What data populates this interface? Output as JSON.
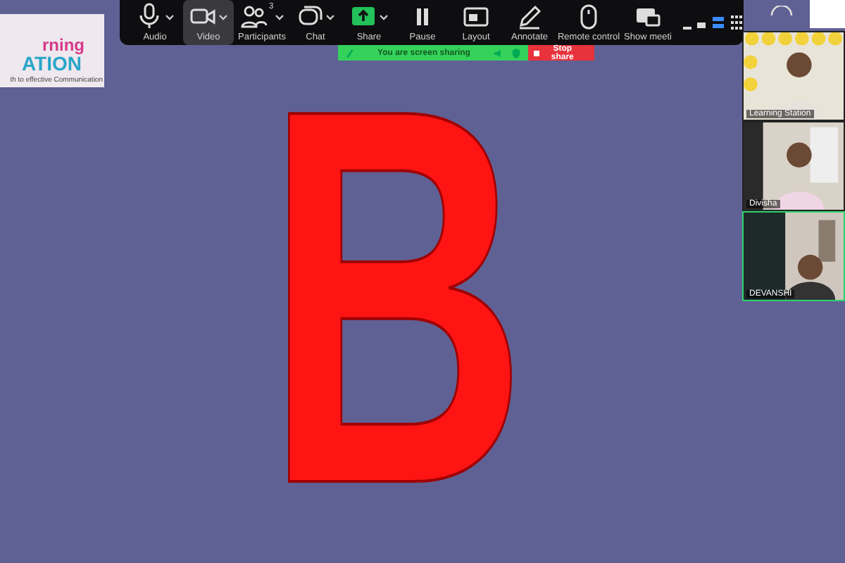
{
  "logo": {
    "lines": [
      "rning",
      "ATION",
      "th to effective Communication"
    ]
  },
  "toolbar": {
    "items": [
      {
        "kind": "mic",
        "label": "Audio",
        "selected": false,
        "caret": true
      },
      {
        "kind": "camera",
        "label": "Video",
        "selected": true,
        "caret": true
      },
      {
        "kind": "people",
        "label": "Participants",
        "selected": false,
        "caret": true,
        "count": "3"
      },
      {
        "kind": "chat",
        "label": "Chat",
        "selected": false,
        "caret": true
      },
      {
        "kind": "share",
        "label": "Share",
        "selected": false,
        "caret": true
      },
      {
        "kind": "pause",
        "label": "Pause",
        "selected": false,
        "caret": false
      },
      {
        "kind": "layout",
        "label": "Layout",
        "selected": false,
        "caret": false
      },
      {
        "kind": "pen",
        "label": "Annotate",
        "selected": false,
        "caret": false
      },
      {
        "kind": "mouse",
        "label": "Remote control",
        "selected": false,
        "caret": false
      },
      {
        "kind": "screens",
        "label": "Show meeti",
        "selected": false,
        "caret": false
      }
    ]
  },
  "sharing_bar": {
    "status": "You are screen sharing",
    "stop": "Stop share"
  },
  "slide": {
    "letter": "B"
  },
  "videos": [
    {
      "name": "Learning Station",
      "active": false
    },
    {
      "name": "Divisha",
      "active": false
    },
    {
      "name": "DEVANSHI",
      "active": true
    }
  ]
}
